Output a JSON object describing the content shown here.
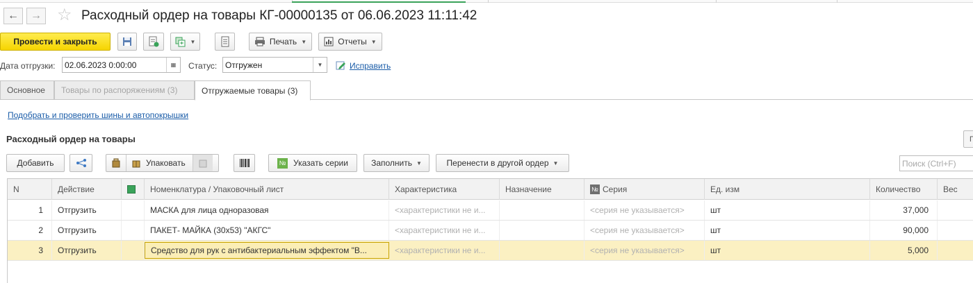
{
  "window": {
    "title": "Расходный ордер на товары КГ-00000135 от 06.06.2023 11:11:42"
  },
  "nav": {
    "back_icon": "arrow-left-icon",
    "forward_icon": "arrow-right-icon",
    "favorite_icon": "star-icon"
  },
  "toolbar": {
    "post_close_label": "Провести и закрыть",
    "print_label": "Печать",
    "reports_label": "Отчеты"
  },
  "header_fields": {
    "ship_date_label": "Дата отгрузки:",
    "ship_date_value": "02.06.2023  0:00:00",
    "status_label": "Статус:",
    "status_value": "Отгружен",
    "fix_link": "Исправить"
  },
  "tabs": [
    {
      "label": "Основное"
    },
    {
      "label": "Товары по распоряжениям (3)"
    },
    {
      "label": "Отгружаемые товары (3)"
    }
  ],
  "tire_link": "Подобрать и проверить шины и автопокрышки",
  "section_title": "Расходный ордер на товары",
  "table_toolbar": {
    "add_label": "Добавить",
    "pack_label": "Упаковать",
    "series_label": "Указать серии",
    "fill_label": "Заполнить",
    "move_label": "Перенести в другой ордер",
    "search_placeholder": "Поиск (Ctrl+F)",
    "edge_button_label": "П"
  },
  "table": {
    "columns": [
      "N",
      "Действие",
      "",
      "Номенклатура / Упаковочный лист",
      "Характеристика",
      "Назначение",
      "Серия",
      "Ед. изм",
      "Количество",
      "Вес"
    ],
    "rows": [
      {
        "n": "1",
        "action": "Отгрузить",
        "item": "МАСКА для лица одноразовая",
        "char": "<характеристики не и...",
        "purpose": "",
        "series": "<серия не указывается>",
        "unit": "шт",
        "qty": "37,000",
        "weight": "<"
      },
      {
        "n": "2",
        "action": "Отгрузить",
        "item": "ПАКЕТ- МАЙКА (30х53) \"АКГС\"",
        "char": "<характеристики не и...",
        "purpose": "",
        "series": "<серия не указывается>",
        "unit": "шт",
        "qty": "90,000",
        "weight": "<"
      },
      {
        "n": "3",
        "action": "Отгрузить",
        "item": "Средство для рук с антибактериальным эффектом \"В...",
        "char": "<характеристики не и...",
        "purpose": "",
        "series": "<серия не указывается>",
        "unit": "шт",
        "qty": "5,000",
        "weight": "<"
      }
    ]
  },
  "colors": {
    "primary_button": "#f6d500",
    "link": "#1a5ca8",
    "selected_row": "#fbf0c2",
    "active_tab_line": "#3aa35a"
  }
}
